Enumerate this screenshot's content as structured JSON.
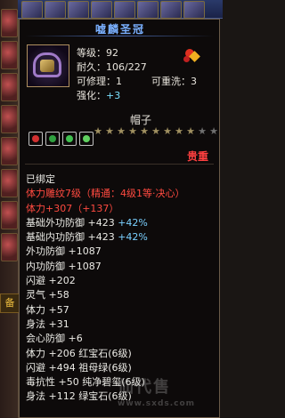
{
  "tooltip": {
    "title": "嘘麟圣冠",
    "level": "等级：92",
    "durability": "耐久：106/227",
    "repairable": "可修理：1",
    "rewashable": "可重洗：3",
    "enhance_label": "强化：",
    "enhance_value": "+3",
    "item_type": "帽子",
    "stars_filled": 9,
    "stars_total": 11,
    "grade": "贵重",
    "lines": [
      {
        "text": "已绑定",
        "color": "white"
      },
      {
        "text": "体力雕纹7级（精通：4级1等·决心）",
        "color": "red"
      },
      {
        "text": "体力+307（+137）",
        "color": "red"
      },
      {
        "text": "基础外功防御 +423 +42%",
        "color": "white",
        "extra": "+42%"
      },
      {
        "text": "基础内功防御 +423 +42%",
        "color": "white",
        "extra": "+42%"
      },
      {
        "text": "外功防御 +1087",
        "color": "white"
      },
      {
        "text": "内功防御 +1087",
        "color": "white"
      },
      {
        "text": "闪避 +202",
        "color": "white"
      },
      {
        "text": "灵气 +58",
        "color": "white"
      },
      {
        "text": "体力 +57",
        "color": "white"
      },
      {
        "text": "身法 +31",
        "color": "white"
      },
      {
        "text": "会心防御 +6",
        "color": "white"
      },
      {
        "text": "体力 +206 红宝石(6级)",
        "color": "white"
      },
      {
        "text": "闪避 +494 祖母绿(6级)",
        "color": "white"
      },
      {
        "text": "毒抗性 +50 纯净碧玺(6级)",
        "color": "white"
      },
      {
        "text": "身法 +112 绿宝石(6级)",
        "color": "white"
      }
    ]
  },
  "side_labels": {
    "equip": "备"
  },
  "watermark": {
    "text": "仙代售",
    "url": "www.sxds.com"
  },
  "colors": {
    "white": "#ecebe6",
    "red": "#ff4a40",
    "cyan": "#7ad0ff",
    "title": "#7ab0ff"
  }
}
